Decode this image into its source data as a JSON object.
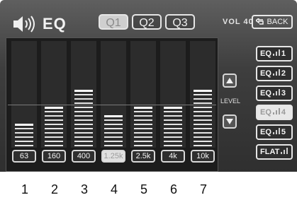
{
  "header": {
    "title": "EQ",
    "speaker_icon": "speaker-icon"
  },
  "presets_q": [
    {
      "label": "Q1",
      "active": true
    },
    {
      "label": "Q2",
      "active": false
    },
    {
      "label": "Q3",
      "active": false
    }
  ],
  "volume": {
    "label": "VOL 40"
  },
  "back_button": {
    "label": "BACK",
    "icon": "back-arrow-icon"
  },
  "bands": [
    {
      "freq": "63",
      "level": 6,
      "marker": "1",
      "active": false
    },
    {
      "freq": "160",
      "level": 10,
      "marker": "2",
      "active": false
    },
    {
      "freq": "400",
      "level": 14,
      "marker": "3",
      "active": false
    },
    {
      "freq": "1.25k",
      "level": 8,
      "marker": "4",
      "active": true
    },
    {
      "freq": "2.5k",
      "level": 10,
      "marker": "5",
      "active": false
    },
    {
      "freq": "4k",
      "level": 10,
      "marker": "6",
      "active": false
    },
    {
      "freq": "10k",
      "level": 14,
      "marker": "7",
      "active": false
    }
  ],
  "level_control": {
    "label": "LEVEL",
    "up_icon": "triangle-up-icon",
    "down_icon": "triangle-down-icon"
  },
  "presets_eq": [
    {
      "label": "EQ",
      "num": "1",
      "active": false
    },
    {
      "label": "EQ",
      "num": "2",
      "active": false
    },
    {
      "label": "EQ",
      "num": "3",
      "active": false
    },
    {
      "label": "EQ",
      "num": "4",
      "active": true
    },
    {
      "label": "EQ",
      "num": "5",
      "active": false
    },
    {
      "label": "FLAT",
      "num": "",
      "active": false
    }
  ]
}
